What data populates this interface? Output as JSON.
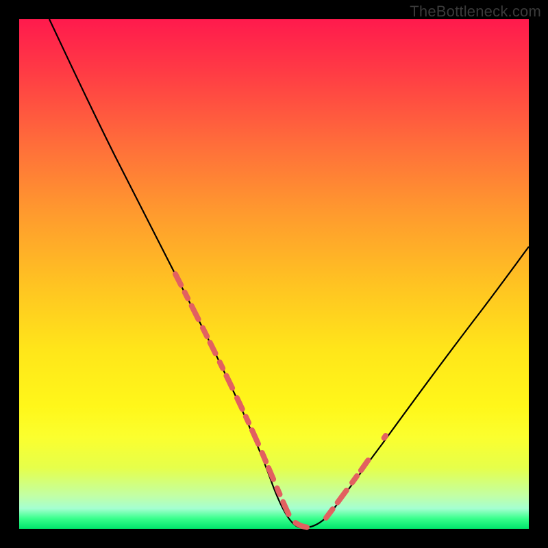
{
  "watermark": "TheBottleneck.com",
  "gradient_colors": {
    "top": "#ff1a4d",
    "mid_orange": "#ff9a2e",
    "yellow": "#ffe61a",
    "pale_yellow": "#fbff2e",
    "pale_green": "#c2ffa5",
    "green": "#00e56b"
  },
  "chart_data": {
    "type": "line",
    "title": "",
    "xlabel": "",
    "ylabel": "",
    "xlim": [
      0,
      100
    ],
    "ylim": [
      0,
      100
    ],
    "series": [
      {
        "name": "curve-main",
        "style": "solid-black",
        "x": [
          6,
          10,
          15,
          20,
          25,
          30,
          35,
          40,
          45,
          47,
          50,
          53,
          55,
          57,
          60,
          65,
          70,
          75,
          80,
          85,
          90,
          95,
          100
        ],
        "y": [
          100,
          92,
          83,
          73,
          62,
          51,
          40,
          28,
          13,
          7,
          2,
          0,
          0,
          0,
          3,
          9,
          17,
          25,
          33,
          41,
          49,
          56,
          62
        ]
      },
      {
        "name": "highlight-left",
        "style": "dashed-red",
        "x": [
          30,
          33,
          36,
          39,
          42,
          44,
          46,
          48,
          50,
          52,
          54,
          56
        ],
        "y": [
          51,
          44,
          36,
          29,
          21,
          14,
          9,
          5,
          2,
          0,
          0,
          0
        ]
      },
      {
        "name": "highlight-right",
        "style": "dashed-red",
        "x": [
          60,
          62,
          64,
          66,
          68,
          70
        ],
        "y": [
          3,
          6,
          8,
          11,
          14,
          17
        ]
      }
    ],
    "annotations": []
  }
}
